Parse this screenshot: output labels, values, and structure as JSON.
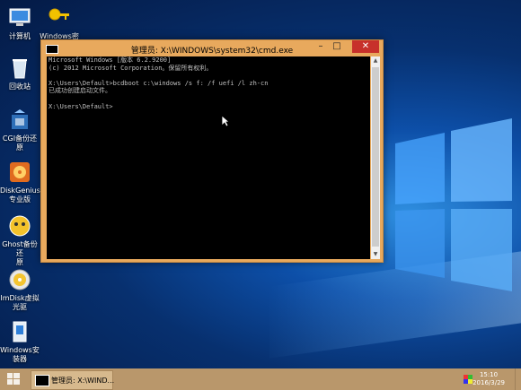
{
  "desktop_icons": [
    {
      "label": "计算机",
      "icon": "computer-icon"
    },
    {
      "label": "Windows密\n钥",
      "icon": "key-icon"
    },
    {
      "label": "回收站",
      "icon": "recycle-bin-icon"
    },
    {
      "label": "CGI备份还原",
      "icon": "cgi-backup-icon"
    },
    {
      "label": "DiskGenius\n专业版",
      "icon": "diskgenius-icon"
    },
    {
      "label": "Ghost备份还\n原",
      "icon": "ghost-icon"
    },
    {
      "label": "ImDisk虚拟\n光驱",
      "icon": "imdisk-icon"
    },
    {
      "label": "Windows安\n装器",
      "icon": "windows-installer-icon"
    }
  ],
  "window": {
    "title": "管理员: X:\\WINDOWS\\system32\\cmd.exe",
    "minimize": "–",
    "maximize": "□",
    "close": "✕"
  },
  "console_lines": [
    "Microsoft Windows [版本 6.2.9200]",
    "(c) 2012 Microsoft Corporation。保留所有权利。",
    "",
    "X:\\Users\\Default>bcdboot c:\\windows /s f: /f uefi /l zh-cn",
    "已成功创建启动文件。",
    "",
    "X:\\Users\\Default>"
  ],
  "taskbar": {
    "task_label": "管理员: X:\\WIND...",
    "time": "15:10",
    "date": "2016/3/29"
  },
  "colors": {
    "accent": "#e8a95d",
    "close": "#c7302b",
    "taskbar": "#b9976b"
  }
}
